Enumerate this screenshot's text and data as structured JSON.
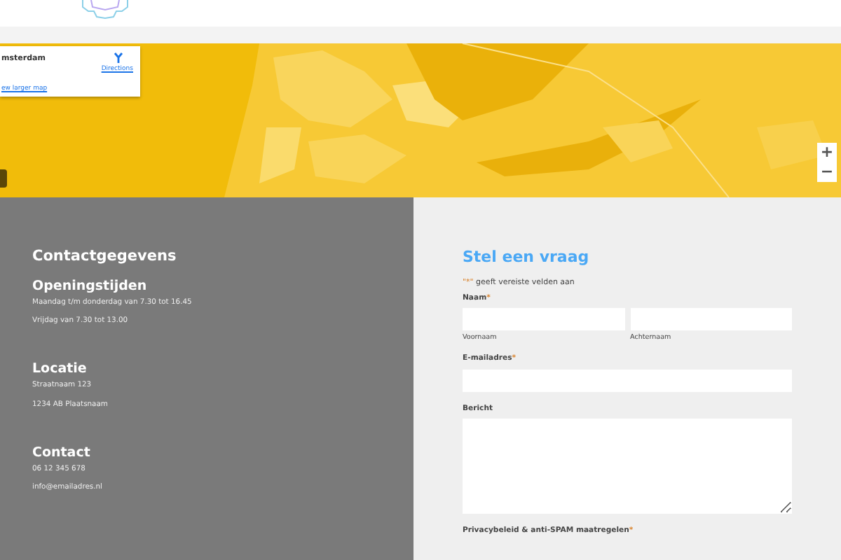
{
  "map": {
    "place_card": {
      "title": "msterdam",
      "directions": "Directions",
      "link": "ew larger map"
    },
    "zoom_in": "+",
    "zoom_out": "−"
  },
  "contact": {
    "title": "Contactgegevens",
    "sections": [
      {
        "heading": "Openingstijden",
        "lines": [
          "Maandag t/m donderdag van 7.30 tot 16.45",
          "Vrijdag van 7.30 tot 13.00"
        ]
      },
      {
        "heading": "Locatie",
        "lines": [
          "Straatnaam 123",
          "1234 AB  Plaatsnaam"
        ]
      },
      {
        "heading": "Contact",
        "lines": [
          "06 12 345 678",
          "info@emailadres.nl"
        ]
      }
    ]
  },
  "form": {
    "title": "Stel een vraag",
    "note_mark": "\"*\"",
    "note": "geeft vereiste velden aan",
    "fields": [
      {
        "kind": "name",
        "label": "Naam",
        "required_mark": "*",
        "sublabels": [
          "Voornaam",
          "Achternaam"
        ]
      },
      {
        "kind": "text",
        "label": "E-mailadres",
        "required_mark": "*"
      },
      {
        "kind": "textarea",
        "label": "Bericht"
      },
      {
        "kind": "heading",
        "label": "Privacybeleid & anti-SPAM maatregelen",
        "required_mark": "*"
      }
    ]
  }
}
